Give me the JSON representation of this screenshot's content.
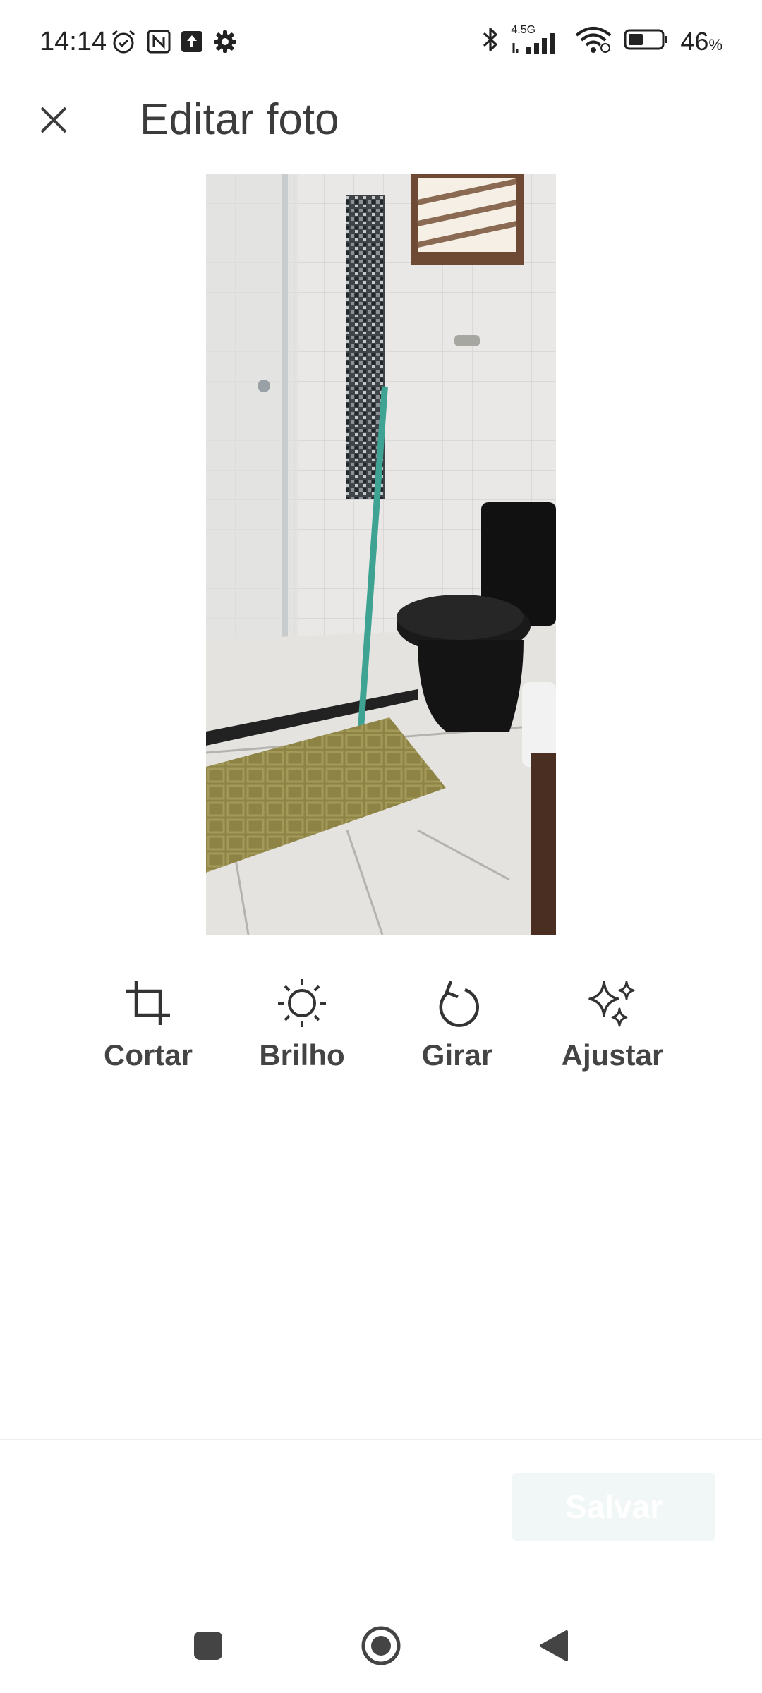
{
  "status_bar": {
    "time": "14:14",
    "network_label": "4.5G",
    "battery_percent": "46",
    "battery_unit": "%",
    "battery_level": 0.46,
    "left_icons": [
      "alarm-icon",
      "nfc-icon",
      "upload-icon",
      "settings-gear-icon"
    ],
    "right_icons": [
      "bluetooth-icon",
      "cellular-signal-icon",
      "wifi-icon",
      "battery-icon"
    ]
  },
  "header": {
    "title": "Editar foto",
    "close_icon": "close-icon"
  },
  "photo": {
    "subject": "bathroom-photo"
  },
  "tools": [
    {
      "label": "Cortar",
      "icon": "crop-icon"
    },
    {
      "label": "Brilho",
      "icon": "brightness-icon"
    },
    {
      "label": "Girar",
      "icon": "rotate-icon"
    },
    {
      "label": "Ajustar",
      "icon": "sparkle-icon"
    }
  ],
  "actions": {
    "save_label": "Salvar"
  },
  "colors": {
    "text": "#3c3c3c",
    "save_button_bg": "#f1f7f6",
    "save_button_text": "#ffffff",
    "divider": "#efefef"
  },
  "nav_bar": {
    "buttons": [
      "recents-square-icon",
      "home-circle-icon",
      "back-triangle-icon"
    ]
  }
}
